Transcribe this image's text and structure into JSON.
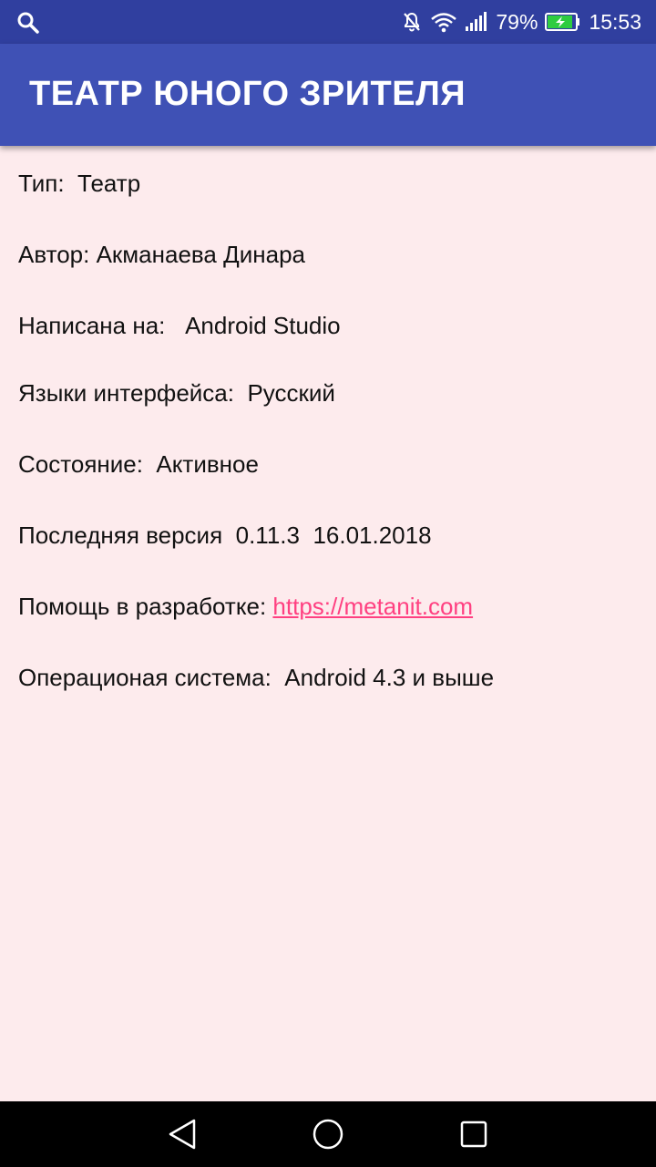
{
  "status_bar": {
    "left_icon": "search-icon",
    "icons": [
      "mute-icon",
      "wifi-icon",
      "signal-icon",
      "battery-charging-icon"
    ],
    "battery_percent": "79%",
    "time": "15:53"
  },
  "app_bar": {
    "title": "ТЕАТР ЮНОГО ЗРИТЕЛЯ",
    "color": "#3f51b5"
  },
  "info": {
    "type_label": "Тип:",
    "type_value": "Театр",
    "author_label": "Автор:",
    "author_value": "Акманаева Динара",
    "written_label": "Написана на:",
    "written_value": "Android Studio",
    "lang_label": "Языки интерфейса:",
    "lang_value": "Русский",
    "state_label": "Состояние:",
    "state_value": "Активное",
    "version_label": "Последняя версия",
    "version_number": "0.11.3",
    "version_date": "16.01.2018",
    "help_label": "Помощь в разработке:",
    "help_link": "https://metanit.com",
    "os_label": "Операционая система:",
    "os_value": "Android 4.3 и выше"
  },
  "nav_bar": {
    "buttons": [
      "back-icon",
      "home-icon",
      "recents-icon"
    ]
  },
  "colors": {
    "background": "#fdebed",
    "status_bar": "#303f9f",
    "link": "#ff4081"
  }
}
